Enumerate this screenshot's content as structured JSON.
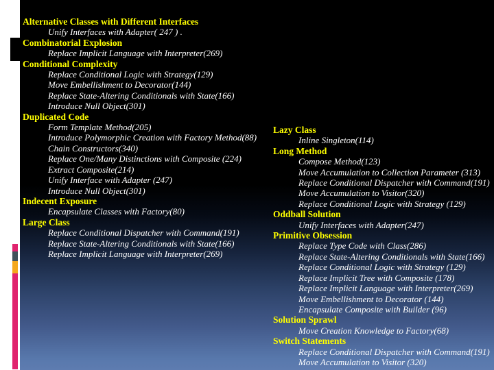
{
  "slide": {
    "background": {
      "top_color": "#000000",
      "bottom_color": "#5e7cb0"
    },
    "accent_colors": {
      "heading": "#ffff00",
      "item": "#ffffff",
      "strip": "#ffffff",
      "bar_pink": "#e0236e",
      "bar_slate": "#41525a",
      "bar_orange": "#f5a81c",
      "strip_box": "#000000"
    }
  },
  "columns": [
    {
      "name": "left-column",
      "groups": [
        {
          "heading": "Alternative Classes with Different Interfaces",
          "items": [
            "Unify Interfaces with Adapter( 247 ) ."
          ]
        },
        {
          "heading": "Combinatorial Explosion",
          "items": [
            "Replace Implicit Language with Interpreter(269)"
          ]
        },
        {
          "heading": "Conditional Complexity",
          "items": [
            "Replace Conditional Logic with Strategy(129)",
            "Move Embellishment to Decorator(144)",
            "Replace State-Altering Conditionals with State(166)",
            "Introduce Null Object(301)"
          ]
        },
        {
          "heading": "Duplicated Code",
          "items": [
            "Form Template Method(205)",
            "Introduce Polymorphic Creation with Factory Method(88)",
            "Chain Constructors(340)",
            "Replace One/Many Distinctions with Composite (224)",
            "Extract Composite(214)",
            "Unify Interface with Adapter (247)",
            "Introduce Null Object(301)"
          ]
        },
        {
          "heading": "Indecent Exposure",
          "items": [
            "Encapsulate Classes with Factory(80)"
          ]
        },
        {
          "heading": "Large Class",
          "items": [
            "Replace Conditional Dispatcher with Command(191)",
            "Replace State-Altering Conditionals with State(166)",
            "Replace Implicit Language with Interpreter(269)"
          ]
        }
      ]
    },
    {
      "name": "right-column",
      "groups": [
        {
          "heading": "Lazy Class",
          "items": [
            "Inline Singleton(114)"
          ]
        },
        {
          "heading": "Long Method",
          "items": [
            "Compose Method(123)",
            "Move Accumulation to Collection Parameter (313)",
            "Replace Conditional Dispatcher with Command(191)",
            "Move Accumulation to Visitor(320)",
            "Replace Conditional Logic with Strategy (129)"
          ]
        },
        {
          "heading": "Oddball Solution",
          "items": [
            "Unify Interfaces with Adapter(247)"
          ]
        },
        {
          "heading": "Primitive Obsession",
          "items": [
            "Replace Type Code with Class(286)",
            "Replace State-Altering Conditionals with State(166)",
            "Replace Conditional Logic with Strategy (129)",
            "Replace Implicit Tree with Composite (178)",
            "Replace Implicit Language with Interpreter(269)",
            "Move Embellishment to Decorator (144)",
            "Encapsulate Composite with Builder (96)"
          ]
        },
        {
          "heading": "Solution Sprawl",
          "items": [
            "Move Creation Knowledge to Factory(68)"
          ]
        },
        {
          "heading": "Switch Statements",
          "items": [
            "Replace Conditional Dispatcher with Command(191)",
            "Move Accumulation to Visitor (320)"
          ]
        }
      ]
    }
  ]
}
